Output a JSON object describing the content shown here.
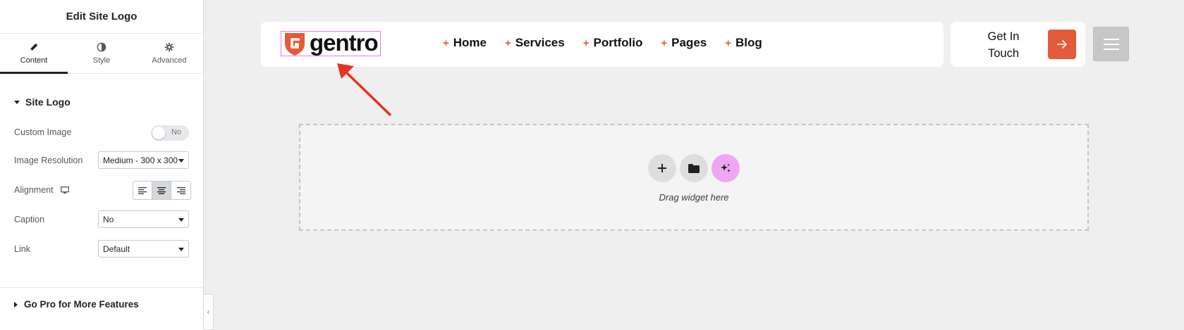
{
  "panel": {
    "title": "Edit Site Logo",
    "tabs": [
      {
        "label": "Content",
        "icon": "pencil-icon",
        "active": true
      },
      {
        "label": "Style",
        "icon": "contrast-icon",
        "active": false
      },
      {
        "label": "Advanced",
        "icon": "gear-icon",
        "active": false
      }
    ],
    "section_title": "Site Logo",
    "custom_image": {
      "label": "Custom Image",
      "toggle_text": "No",
      "enabled": false
    },
    "image_resolution": {
      "label": "Image Resolution",
      "value": "Medium - 300 x 300"
    },
    "alignment": {
      "label": "Alignment",
      "device_icon": "desktop-icon",
      "selected": "center"
    },
    "caption": {
      "label": "Caption",
      "value": "No"
    },
    "link": {
      "label": "Link",
      "value": "Default"
    },
    "go_pro": "Go Pro for More Features"
  },
  "canvas": {
    "logo_text": "gentro",
    "menu": [
      {
        "label": "Home"
      },
      {
        "label": "Services"
      },
      {
        "label": "Portfolio"
      },
      {
        "label": "Pages"
      },
      {
        "label": "Blog"
      }
    ],
    "menu_marker": "+",
    "cta": {
      "line1": "Get In",
      "line2": "Touch"
    },
    "dropzone": {
      "text": "Drag widget here"
    }
  },
  "colors": {
    "accent": "#e35b3a",
    "selection_outline": "#e07cf0",
    "ai_button": "#f0a6f5",
    "annotation_arrow": "#e8321f"
  }
}
